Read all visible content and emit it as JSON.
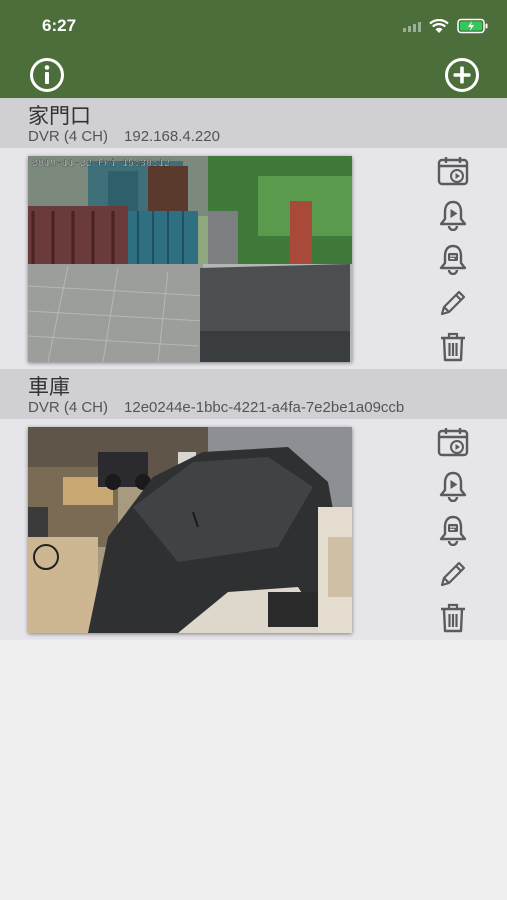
{
  "status": {
    "time": "6:27"
  },
  "colors": {
    "nav": "#4c6e3a",
    "header": "#cfcfd4",
    "row": "#e6e5ea",
    "icon": "#5b5b5b"
  },
  "nav": {
    "left_icon": "info-icon",
    "right_icon": "plus-icon"
  },
  "devices": [
    {
      "name": "家門口",
      "type": "DVR (4 CH)",
      "address": "192.168.4.220",
      "osd": "2019-11-22 Fri 15:30:12",
      "actions": [
        "calendar-playback-icon",
        "alarm-playback-icon",
        "alarm-message-icon",
        "edit-icon",
        "delete-icon"
      ]
    },
    {
      "name": "車庫",
      "type": "DVR (4 CH)",
      "address": "12e0244e-1bbc-4221-a4fa-7e2be1a09ccb",
      "osd": "",
      "actions": [
        "calendar-playback-icon",
        "alarm-playback-icon",
        "alarm-message-icon",
        "edit-icon",
        "delete-icon"
      ]
    }
  ]
}
